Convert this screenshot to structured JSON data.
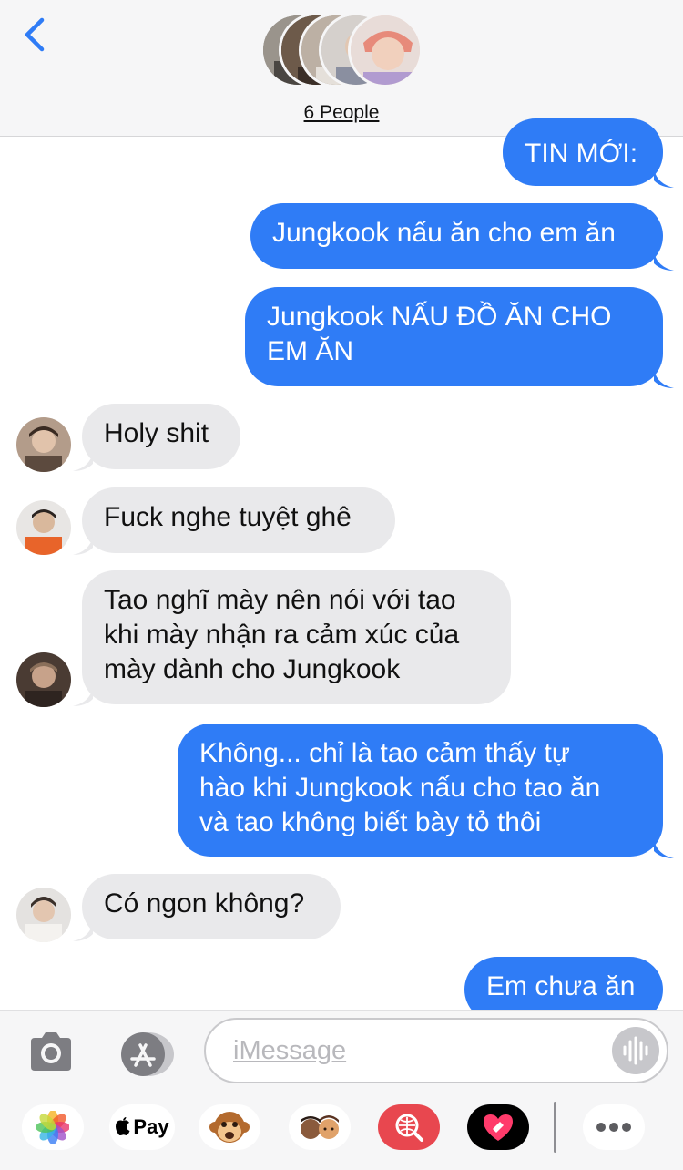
{
  "header": {
    "group_label": "6 People"
  },
  "messages": [
    {
      "id": "m1",
      "direction": "outgoing",
      "lines": [
        "TIN MỚI:"
      ]
    },
    {
      "id": "m2",
      "direction": "outgoing",
      "lines": [
        "Jungkook nấu ăn cho em ăn"
      ]
    },
    {
      "id": "m3",
      "direction": "outgoing",
      "lines": [
        "Jungkook NẤU ĐỒ ĂN CHO",
        "EM ĂN"
      ]
    },
    {
      "id": "m4",
      "direction": "incoming",
      "lines": [
        "Holy shit"
      ]
    },
    {
      "id": "m5",
      "direction": "incoming",
      "lines": [
        "Fuck nghe tuyệt ghê"
      ]
    },
    {
      "id": "m6",
      "direction": "incoming",
      "lines": [
        "Tao nghĩ mày nên nói với tao",
        "khi mày nhận ra cảm xúc của",
        "mày dành cho Jungkook"
      ]
    },
    {
      "id": "m7",
      "direction": "outgoing",
      "lines": [
        "Không... chỉ là tao cảm thấy tự",
        "hào khi Jungkook nấu cho tao ăn",
        "và tao không biết bày tỏ thôi"
      ]
    },
    {
      "id": "m8",
      "direction": "incoming",
      "lines": [
        "Có ngon không?"
      ]
    },
    {
      "id": "m9",
      "direction": "outgoing",
      "lines": [
        "Em chưa ăn"
      ]
    }
  ],
  "composer": {
    "placeholder": "iMessage",
    "apple_pay_label": "Pay"
  },
  "colors": {
    "outgoing_bubble": "#2f7cf6",
    "incoming_bubble": "#e9e9eb",
    "accent": "#2f7cf6"
  },
  "icons": [
    "back-chevron-icon",
    "camera-icon",
    "app-store-icon",
    "voice-waveform-icon",
    "photos-app-icon",
    "apple-pay-icon",
    "animoji-monkey-icon",
    "memoji-icon",
    "image-search-icon",
    "digital-touch-icon",
    "more-apps-icon"
  ]
}
